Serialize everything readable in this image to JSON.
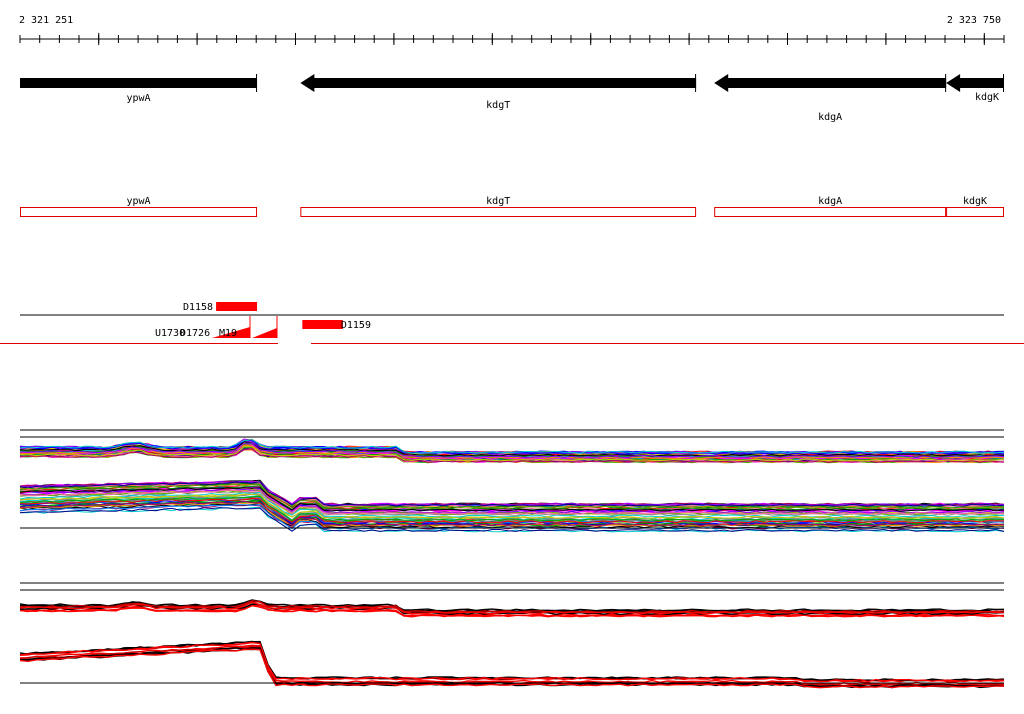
{
  "ruler": {
    "start_label": "2 321 251",
    "end_label": "2 323 750"
  },
  "genes": [
    {
      "name": "ypwA",
      "start": 2321251,
      "end": 2321853,
      "strand": "+"
    },
    {
      "name": "kdgT",
      "start": 2321963,
      "end": 2322968,
      "strand": "-"
    },
    {
      "name": "kdgA",
      "start": 2323014,
      "end": 2323603,
      "strand": "-"
    },
    {
      "name": "kdgK",
      "start": 2323603,
      "end": 2323750,
      "strand": "-"
    }
  ],
  "features": [
    {
      "name": "D1158",
      "start": 2321749,
      "end": 2321853
    },
    {
      "name": "D1159",
      "start": 2321968,
      "end": 2322071
    }
  ],
  "overlap_labels": [
    "U1730",
    "D1726",
    "M19"
  ],
  "colors": {
    "gene": "#000000",
    "annotation": "#e00000",
    "feature": "#ff0000",
    "axis": "#000000"
  }
}
